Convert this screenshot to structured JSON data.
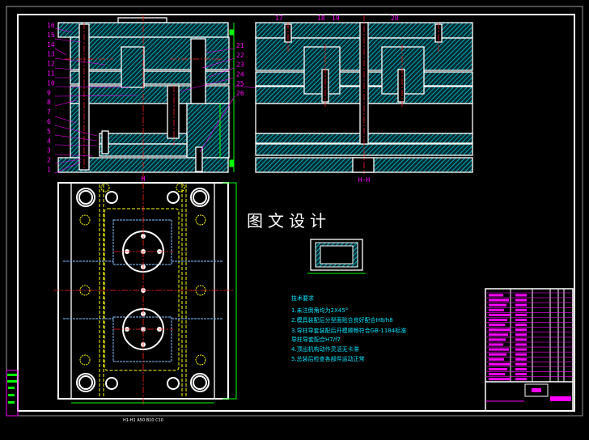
{
  "watermark": "图文设计",
  "section_label": "H—H",
  "plan_marker": "H",
  "left_part_labels": [
    "16",
    "15",
    "14",
    "13",
    "12",
    "11",
    "10",
    "9",
    "8",
    "7",
    "6",
    "5",
    "4",
    "3",
    "2",
    "1"
  ],
  "right_part_labels": [
    "21",
    "22",
    "23",
    "24",
    "25",
    "26"
  ],
  "top_part_labels": [
    "17",
    "18",
    "19",
    "20"
  ],
  "requirements": {
    "title": "技术要求",
    "items": [
      "1.未注倒角均为2X45°",
      "2.模具装配后分型面贴合良好配合H8/h8",
      "3.导柱导套装配后开模顺畅符合GB-1184标准",
      "  导柱导套配合H7/f7",
      "4.顶出机构动作灵活无卡滞",
      "5.总装后检查各部件运动正常"
    ]
  },
  "bottom_note": "H1-H1 A50 B10 C10",
  "colors": {
    "hatch": "#00c8d8",
    "outline": "#ffffff",
    "center": "#ff2020",
    "leader": "#ff00ff",
    "dim": "#00ff00",
    "hidden": "#ffff00",
    "cooling": "#6a9fd8"
  }
}
